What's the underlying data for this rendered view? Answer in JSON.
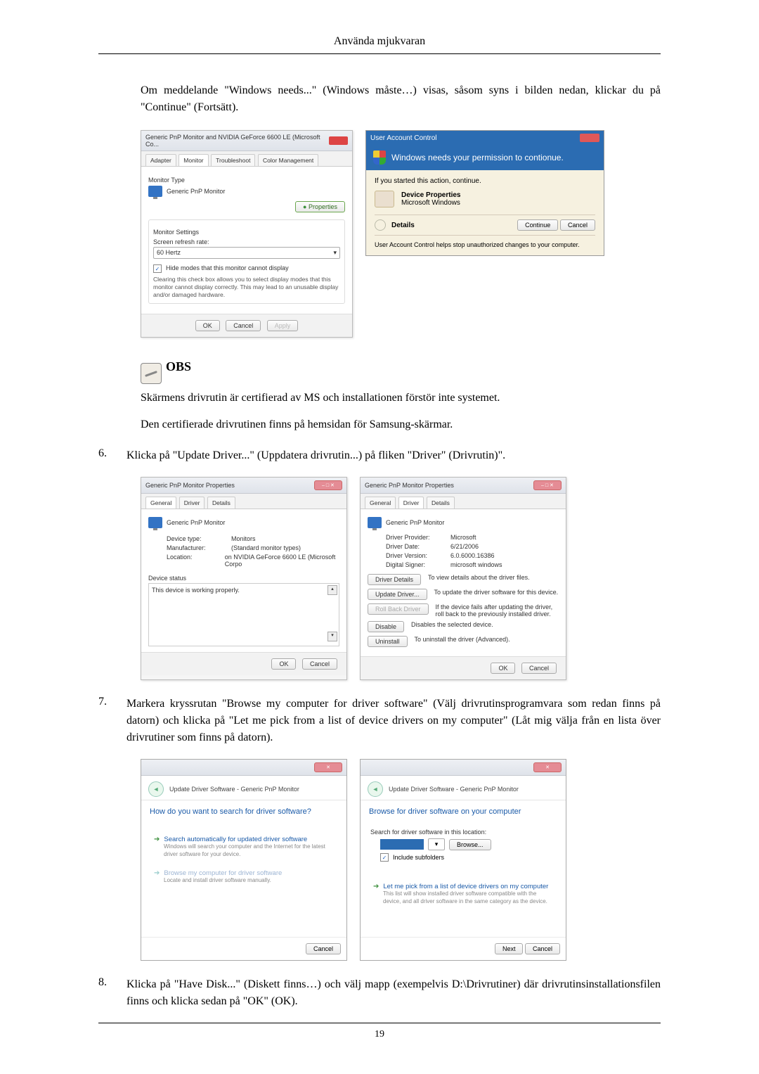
{
  "header": {
    "title": "Använda mjukvaran"
  },
  "para1": "Om meddelande \"Windows needs...\" (Windows måste…) visas, såsom syns i bilden nedan, klickar du på \"Continue\" (Fortsätt).",
  "fig1": {
    "left": {
      "titlebar": "Generic PnP Monitor and NVIDIA GeForce 6600 LE (Microsoft Co...",
      "tabs": [
        "Adapter",
        "Monitor",
        "Troubleshoot",
        "Color Management"
      ],
      "monitor_type_label": "Monitor Type",
      "monitor_name": "Generic PnP Monitor",
      "properties_btn": "Properties",
      "settings_label": "Monitor Settings",
      "refresh_label": "Screen refresh rate:",
      "refresh_value": "60 Hertz",
      "hide_modes": "Hide modes that this monitor cannot display",
      "hide_note": "Clearing this check box allows you to select display modes that this monitor cannot display correctly. This may lead to an unusable display and/or damaged hardware.",
      "ok": "OK",
      "cancel": "Cancel",
      "apply": "Apply"
    },
    "right": {
      "titlebar": "User Account Control",
      "banner": "Windows needs your permission to contionue.",
      "ifstarted": "If you started this action, continue.",
      "devprops": "Device Properties",
      "mswin": "Microsoft Windows",
      "details": "Details",
      "continue": "Continue",
      "cancel": "Cancel",
      "footer": "User Account Control helps stop unauthorized changes to your computer."
    }
  },
  "obs_label": "OBS",
  "obs_line1": "Skärmens drivrutin är certifierad av MS och installationen förstör inte systemet.",
  "obs_line2": "Den certifierade drivrutinen finns på hemsidan för Samsung-skärmar.",
  "step6_num": "6.",
  "step6": "Klicka på \"Update Driver...\" (Uppdatera drivrutin...) på fliken \"Driver\" (Drivrutin)\".",
  "fig2": {
    "left": {
      "titlebar": "Generic PnP Monitor Properties",
      "tabs": [
        "General",
        "Driver",
        "Details"
      ],
      "monitor_name": "Generic PnP Monitor",
      "devtype_k": "Device type:",
      "devtype_v": "Monitors",
      "manu_k": "Manufacturer:",
      "manu_v": "(Standard monitor types)",
      "loc_k": "Location:",
      "loc_v": "on NVIDIA GeForce 6600 LE (Microsoft Corpo",
      "status_label": "Device status",
      "status_text": "This device is working properly.",
      "ok": "OK",
      "cancel": "Cancel"
    },
    "right": {
      "titlebar": "Generic PnP Monitor Properties",
      "tabs": [
        "General",
        "Driver",
        "Details"
      ],
      "monitor_name": "Generic PnP Monitor",
      "prov_k": "Driver Provider:",
      "prov_v": "Microsoft",
      "date_k": "Driver Date:",
      "date_v": "6/21/2006",
      "ver_k": "Driver Version:",
      "ver_v": "6.0.6000.16386",
      "sign_k": "Digital Signer:",
      "sign_v": "microsoft windows",
      "btn_details": "Driver Details",
      "d_details": "To view details about the driver files.",
      "btn_update": "Update Driver...",
      "d_update": "To update the driver software for this device.",
      "btn_rollback": "Roll Back Driver",
      "d_rollback": "If the device fails after updating the driver, roll back to the previously installed driver.",
      "btn_disable": "Disable",
      "d_disable": "Disables the selected device.",
      "btn_uninstall": "Uninstall",
      "d_uninstall": "To uninstall the driver (Advanced).",
      "ok": "OK",
      "cancel": "Cancel"
    }
  },
  "step7_num": "7.",
  "step7": "Markera kryssrutan \"Browse my computer for driver software\" (Välj drivrutinsprogramvara som redan finns på datorn) och klicka på \"Let me pick from a list of device drivers on my computer\" (Låt mig välja från en lista över drivrutiner som finns på datorn).",
  "fig3": {
    "left": {
      "crumb": "Update Driver Software - Generic PnP Monitor",
      "heading": "How do you want to search for driver software?",
      "opt1": "Search automatically for updated driver software",
      "opt1_sub": "Windows will search your computer and the Internet for the latest driver software for your device.",
      "opt2": "Browse my computer for driver software",
      "opt2_sub": "Locate and install driver software manually.",
      "cancel": "Cancel"
    },
    "right": {
      "crumb": "Update Driver Software - Generic PnP Monitor",
      "heading": "Browse for driver software on your computer",
      "search_label": "Search for driver software in this location:",
      "browse": "Browse...",
      "include": "Include subfolders",
      "opt": "Let me pick from a list of device drivers on my computer",
      "opt_sub": "This list will show installed driver software compatible with the device, and all driver software in the same category as the device.",
      "next": "Next",
      "cancel": "Cancel"
    }
  },
  "step8_num": "8.",
  "step8": "Klicka på \"Have Disk...\" (Diskett finns…) och välj mapp (exempelvis D:\\Drivrutiner) där drivrutinsinstallationsfilen finns och klicka sedan på \"OK\" (OK).",
  "page_number": "19"
}
